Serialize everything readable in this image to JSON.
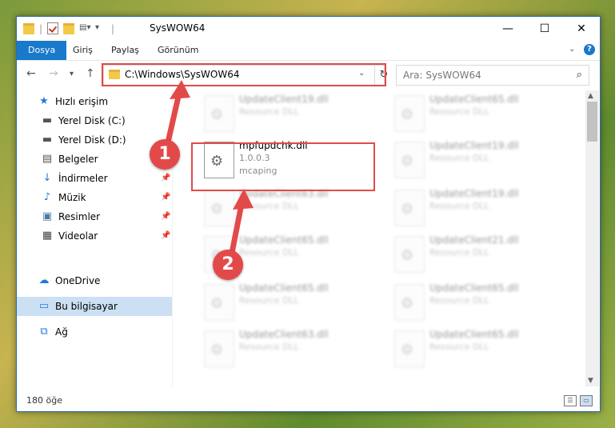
{
  "window": {
    "title": "SysWOW64",
    "qat_sep": "|",
    "controls": {
      "minimize": "—",
      "maximize": "☐",
      "close": "✕"
    }
  },
  "ribbon": {
    "tabs": [
      {
        "label": "Dosya",
        "active": true
      },
      {
        "label": "Giriş"
      },
      {
        "label": "Paylaş"
      },
      {
        "label": "Görünüm"
      }
    ],
    "expand_glyph": "⌄",
    "help_glyph": "?"
  },
  "address": {
    "path": "C:\\Windows\\SysWOW64",
    "search_placeholder": "Ara: SysWOW64"
  },
  "nav": {
    "items": [
      {
        "label": "Hızlı erişim",
        "icon": "star-icon",
        "glyph": "★",
        "color": "#1e7bd6"
      },
      {
        "label": "Yerel Disk (C:)",
        "icon": "drive-icon",
        "glyph": "▬",
        "color": "#555"
      },
      {
        "label": "Yerel Disk (D:)",
        "icon": "drive-icon",
        "glyph": "▬",
        "color": "#555"
      },
      {
        "label": "Belgeler",
        "icon": "documents-icon",
        "glyph": "▤",
        "color": "#555"
      },
      {
        "label": "İndirmeler",
        "icon": "download-icon",
        "glyph": "↓",
        "color": "#1e7bd6"
      },
      {
        "label": "Müzik",
        "icon": "music-icon",
        "glyph": "♪",
        "color": "#1e7bd6"
      },
      {
        "label": "Resimler",
        "icon": "pictures-icon",
        "glyph": "▣",
        "color": "#4a7aa8"
      },
      {
        "label": "Videolar",
        "icon": "video-icon",
        "glyph": "▦",
        "color": "#444"
      },
      {
        "label": "OneDrive",
        "icon": "cloud-icon",
        "glyph": "☁",
        "color": "#1e7bd6"
      },
      {
        "label": "Bu bilgisayar",
        "icon": "computer-icon",
        "glyph": "▭",
        "color": "#1e7bd6",
        "selected": true
      },
      {
        "label": "Ağ",
        "icon": "network-icon",
        "glyph": "⧉",
        "color": "#1e7bd6"
      }
    ]
  },
  "files": {
    "left_column": [
      {
        "name": "UpdateClient19.dll",
        "type": "Resource DLL"
      },
      {
        "name": "mpfupdchk.dll",
        "version": "1.0.0.3",
        "company": "mcaping",
        "highlighted": true
      },
      {
        "name": "UpdateClient63.dll",
        "type": "Resource DLL"
      },
      {
        "name": "UpdateClient65.dll",
        "type": "Resource DLL"
      },
      {
        "name": "UpdateClient65.dll",
        "type": "Resource DLL"
      },
      {
        "name": "UpdateClient63.dll",
        "type": "Resource DLL"
      }
    ],
    "right_column": [
      {
        "name": "UpdateClient65.dll",
        "type": "Resource DLL"
      },
      {
        "name": "UpdateClient19.dll",
        "type": "Resource DLL"
      },
      {
        "name": "UpdateClient19.dll",
        "type": "Resource DLL"
      },
      {
        "name": "UpdateClient21.dll",
        "type": "Resource DLL"
      },
      {
        "name": "UpdateClient65.dll",
        "type": "Resource DLL"
      },
      {
        "name": "UpdateClient65.dll",
        "type": "Resource DLL"
      }
    ]
  },
  "status": {
    "count": "180 öğe"
  },
  "annotations": {
    "marker1": "1",
    "marker2": "2",
    "color": "#e24a4a"
  }
}
